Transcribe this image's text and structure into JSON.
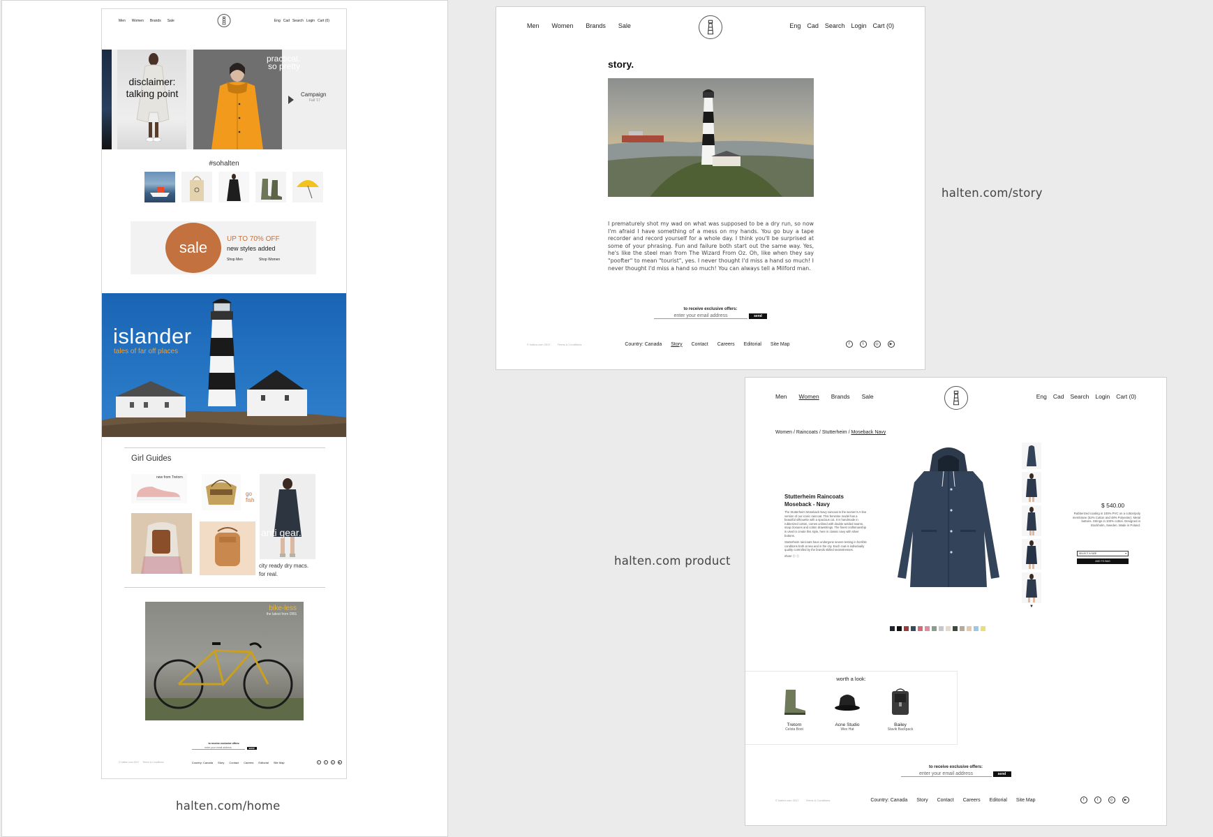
{
  "captions": {
    "home": "halten.com/home",
    "story": "halten.com/story",
    "product": "halten.com product"
  },
  "nav": {
    "left": [
      "Men",
      "Women",
      "Brands",
      "Sale"
    ],
    "right": [
      "Eng",
      "Cad",
      "Search",
      "Login",
      "Cart (0)"
    ]
  },
  "home": {
    "hero": {
      "disclaimer": "disclaimer: talking point",
      "practical_line1": "practical.",
      "practical_line2": "so pretty",
      "campaign": "Campaign",
      "campaign_sub": "Fall '17"
    },
    "insta_tag": "#sohalten",
    "sale": {
      "badge": "sale",
      "headline": "UP TO 70% OFF",
      "subline": "new styles added",
      "shop_men": "Shop Men",
      "shop_women": "Shop Women"
    },
    "islander": {
      "title": "islander",
      "subtitle": "tales of far off places"
    },
    "girl_guides": {
      "title": "Girl Guides",
      "new_from": "new from Tretorn",
      "go_fish_1": "go",
      "go_fish_2": "fish",
      "anti_gear": "anti gear.",
      "city_line1": "city ready dry macs.",
      "city_line2": "for real."
    },
    "bike": {
      "title": "bike-less",
      "subtitle": "the latest from DBS"
    },
    "newsletter": {
      "label": "to receive exclusive offers:",
      "placeholder": "enter your email address",
      "button": "send"
    },
    "footer": {
      "copyright": "© halten.com 2017",
      "terms": "Terms & Conditions",
      "links": [
        "Country: Canada",
        "Story",
        "Contact",
        "Careers",
        "Editorial",
        "Site Map"
      ]
    }
  },
  "story": {
    "title": "story.",
    "body": "I prematurely shot my wad on what was supposed to be a dry run, so now I'm afraid I have something of a mess on my hands. You go buy a tape recorder and record yourself for a whole day. I think you'll be surprised at some of your phrasing. Fun and failure both start out the same way. Yes, he's like the steel man from The Wizard From Oz. Oh, like when they say \"poofter\" to mean \"tourist\", yes. I never thought I'd miss a hand so much! I never thought I'd miss a hand so much! You can always tell a Milford man.",
    "newsletter": {
      "label": "to receive exclusive offers:",
      "placeholder": "enter your email address",
      "button": "send"
    },
    "footer": {
      "copyright": "© halten.com 2017",
      "terms": "Terms & Conditions",
      "links": [
        "Country: Canada",
        "Story",
        "Contact",
        "Careers",
        "Editorial",
        "Site Map"
      ]
    }
  },
  "product": {
    "breadcrumb": [
      "Women",
      "Raincoats",
      "Stutterheim"
    ],
    "breadcrumb_current": "Moseback Navy",
    "name_line1": "Stutterheim Raincoats",
    "name_line2": "Moseback - Navy",
    "description1": "The Stutterheim Moseback Navy raincoat is the women's A-line version of our iconic raincoat. This feminine model has a beautiful silhouette with a spacious cut. It is handmade in rubberized cotton, comes unlined with double welded seams, snap closures and cotton drawstrings. The finest craftsmanship is used to create this style, here in classic navy with silver buttons.",
    "description2": "Stutterheim raincoats have undergone severe testing in horrible conditions both at sea and in the city. Each coat is individually quality controlled by the brands skilled seamstresses.",
    "share": "share",
    "price": "$ 540.00",
    "details": "Rubberized coating in 100% PVC on a cotton/poly membrane (52% Cotton and 48% Polyester). Metal buttons. Strings in 100% cotton. Designed in Stockholm, Sweden. Made in Poland.",
    "size_select": "SELECT A SIZE",
    "add_to_bag": "ADD TO BAG",
    "swatch_colors": [
      "#1e2430",
      "#111111",
      "#a23a3a",
      "#3a4a5c",
      "#d46a78",
      "#e58c9c",
      "#8c9c8c",
      "#c8c8c8",
      "#e6d9c8",
      "#3c4a3a",
      "#b8a89a",
      "#e8c8a8",
      "#9ac8e8",
      "#e8e070"
    ],
    "worth_a_look": {
      "title": "worth a look:",
      "items": [
        {
          "name": "Tretorn",
          "sub": "Celsta Boot"
        },
        {
          "name": "Acne Studio",
          "sub": "Wex Hat"
        },
        {
          "name": "Bailey",
          "sub": "Stavik Backpack"
        }
      ]
    },
    "newsletter": {
      "label": "to receive exclusive offers:",
      "placeholder": "enter your email address",
      "button": "send"
    },
    "footer": {
      "copyright": "© halten.com 2017",
      "terms": "Terms & Conditions",
      "links": [
        "Country: Canada",
        "Story",
        "Contact",
        "Careers",
        "Editorial",
        "Site Map"
      ]
    }
  }
}
